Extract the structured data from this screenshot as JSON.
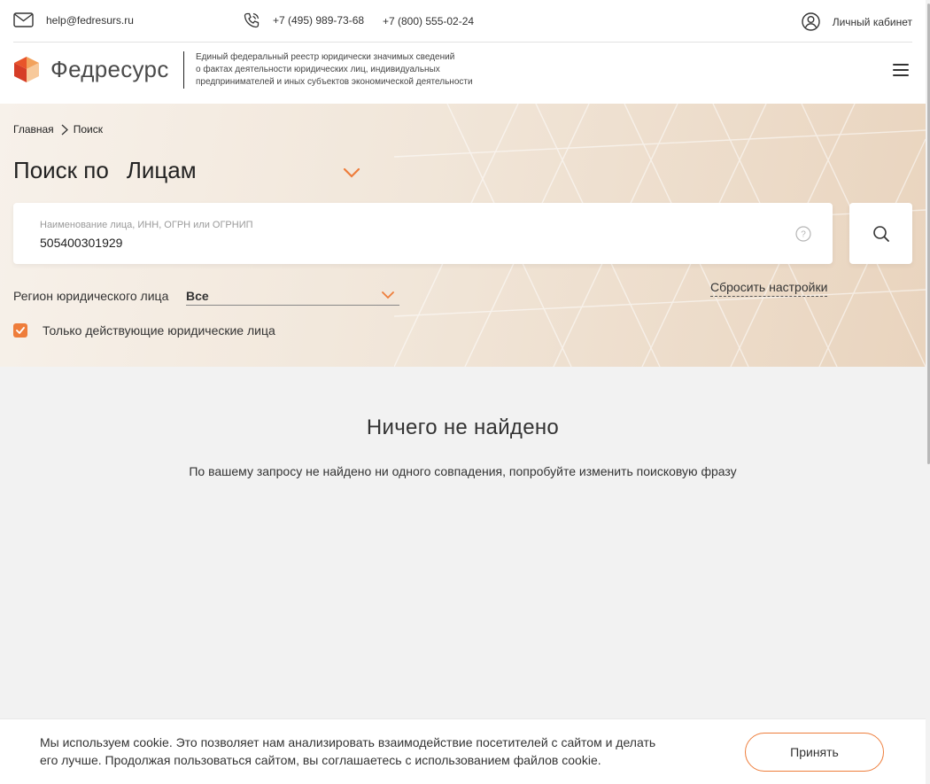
{
  "header": {
    "email": "help@fedresurs.ru",
    "phone_1": "+7 (495) 989-73-68",
    "phone_2": "+7 (800) 555-02-24",
    "cabinet_label": "Личный кабинет",
    "brand_name": "Федресурс",
    "tagline_lines": [
      "Единый федеральный реестр юридически значимых сведений",
      "о фактах деятельности юридических лиц, индивидуальных",
      "предпринимателей и иных субъектов экономической деятельности"
    ]
  },
  "breadcrumb": {
    "home": "Главная",
    "current": "Поиск"
  },
  "search": {
    "title_prefix": "Поиск по",
    "mode": "Лицам",
    "field_label": "Наименование лица, ИНН, ОГРН или ОГРНИП",
    "query": "505400301929"
  },
  "filters": {
    "region_label": "Регион юридического лица",
    "region_value": "Все",
    "reset_label": "Сбросить настройки",
    "active_only_label": "Только действующие юридические лица",
    "active_only_checked": true
  },
  "results": {
    "empty_title": "Ничего не найдено",
    "empty_text": "По вашему запросу не найдено ни одного совпадения, попробуйте изменить поисковую фразу"
  },
  "cookie": {
    "text_lines": [
      "Мы используем cookie. Это позволяет нам анализировать взаимодействие посетителей с сайтом и делать",
      "его лучше. Продолжая пользоваться сайтом, вы соглашаетесь с использованием файлов cookie."
    ],
    "accept_label": "Принять"
  },
  "colors": {
    "accent": "#ee7d3b",
    "text": "#333333",
    "page_bg": "#f2f2f2"
  },
  "icons": [
    "mail-icon",
    "phone-icon",
    "user-circle-icon",
    "logo-icon",
    "menu-icon",
    "chevron-right-icon",
    "chevron-down-icon",
    "help-icon",
    "search-icon",
    "check-icon"
  ]
}
